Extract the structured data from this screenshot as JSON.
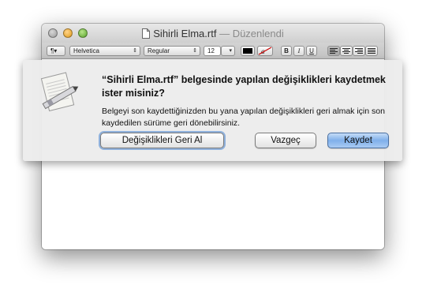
{
  "window": {
    "title_name": "Sihirli Elma.rtf",
    "title_sep": " — ",
    "title_status": "Düzenlendi"
  },
  "toolbar": {
    "paragraph": "¶▾",
    "font_family": "Helvetica",
    "font_style": "Regular",
    "font_size": "12",
    "bold": "B",
    "italic": "I",
    "underline": "U"
  },
  "dialog": {
    "message": "“Sihirli Elma.rtf” belgesinde yapılan değişiklikleri kaydetmek ister misiniz?",
    "informative": "Belgeyi son kaydettiğinizden bu yana yapılan değişiklikleri geri almak için son kaydedilen sürüme geri dönebilirsiniz.",
    "revert_button": "Değişiklikleri Geri Al",
    "cancel_button": "Vazgeç",
    "save_button": "Kaydet"
  },
  "icons": {
    "app": "textedit-icon",
    "document": "document-icon"
  },
  "colors": {
    "default_button": "#7fb0ea",
    "focus_ring": "#8fb1dc"
  }
}
